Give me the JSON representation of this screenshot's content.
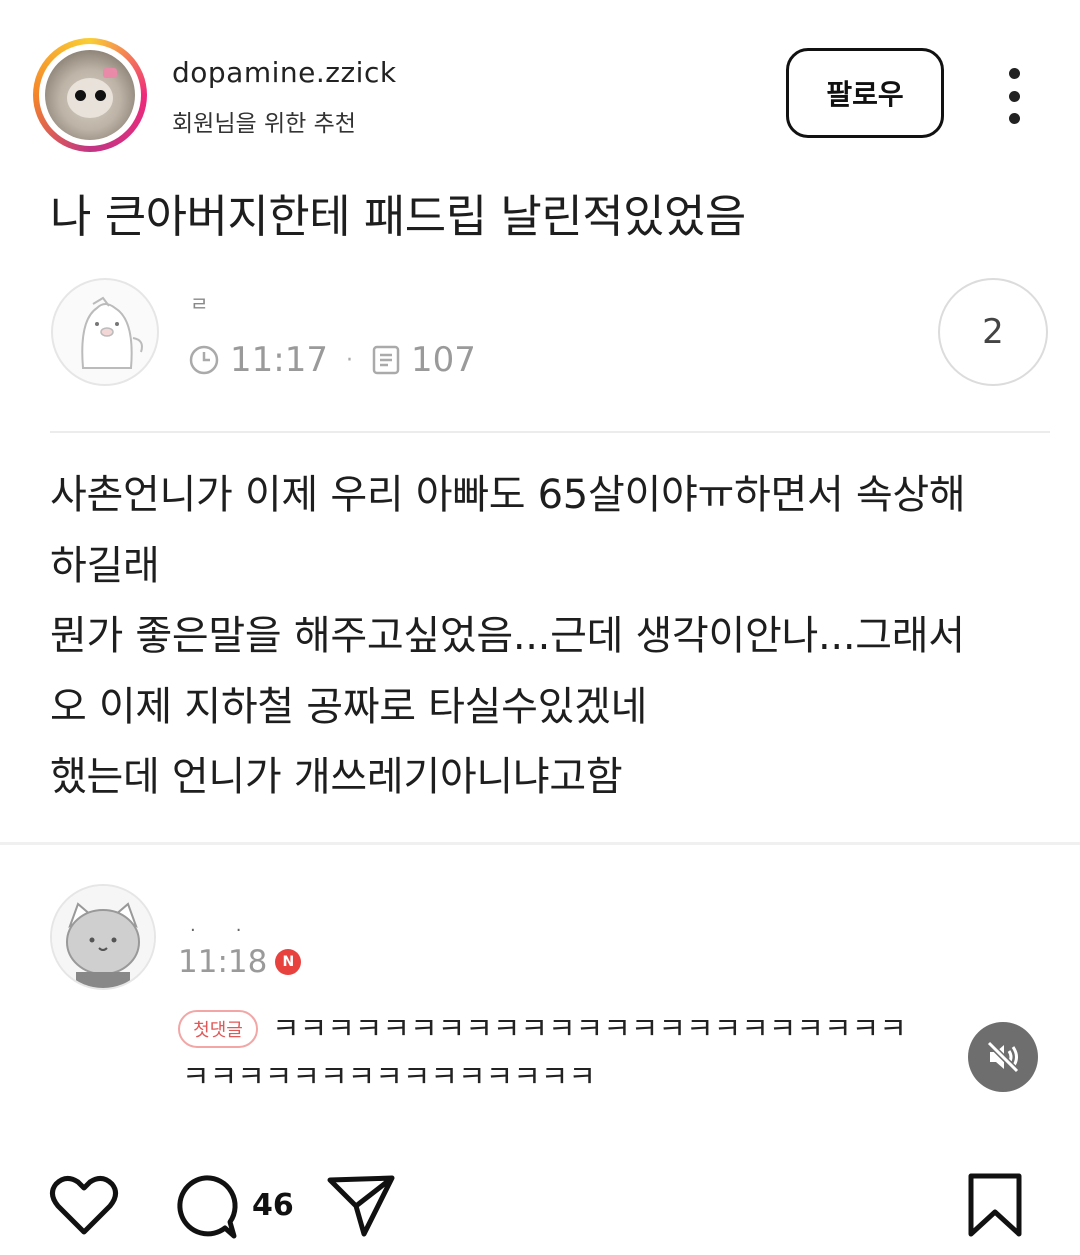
{
  "header": {
    "username": "dopamine.zzick",
    "subtitle": "회원님을 위한 추천",
    "follow_label": "팔로우",
    "more_icon": "more-vertical-icon"
  },
  "post": {
    "title": "나 큰아버지한테 패드립 날린적있었음",
    "author_name": "ㄹ",
    "time": "11:17",
    "views": "107",
    "reply_count": "2",
    "body_lines": [
      "사촌언니가 이제 우리 아빠도 65살이야ㅠ하면서 속상해",
      "하길래",
      "뭔가 좋은말을 해주고싶었음...근데 생각이안나...그래서",
      "오 이제 지하철 공짜로 타실수있겠네",
      "했는데 언니가 개쓰레기아니냐고함"
    ]
  },
  "comment": {
    "author_name": "··",
    "time": "11:18",
    "new_badge": "N",
    "first_badge": "첫댓글",
    "text_line1": "ㅋㅋㅋㅋㅋㅋㅋㅋㅋㅋㅋㅋㅋㅋㅋㅋㅋㅋㅋㅋㅋㅋㅋ",
    "text_line2": "ㅋㅋㅋㅋㅋㅋㅋㅋㅋㅋㅋㅋㅋㅋㅋ"
  },
  "actions": {
    "comment_count": "46"
  },
  "colors": {
    "accent_red": "#e8423f",
    "ring_gradient": [
      "#f9ce34",
      "#ee2a7b",
      "#c13584",
      "#f58529"
    ]
  }
}
